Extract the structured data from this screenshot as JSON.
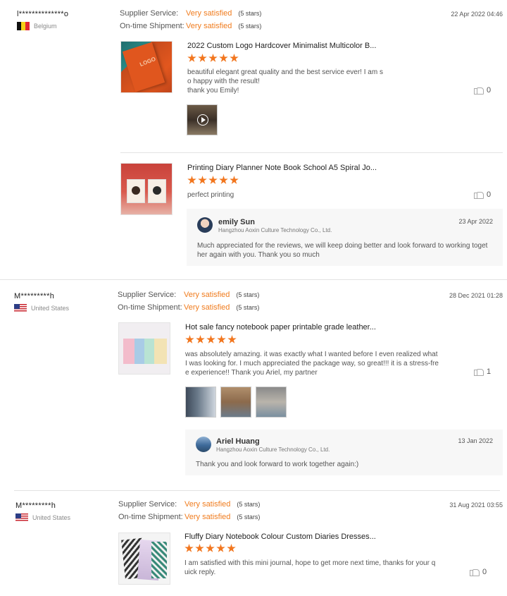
{
  "reviews": [
    {
      "user": "l**************o",
      "country": "Belgium",
      "supplier_service_label": "Supplier Service:",
      "supplier_service_value": "Very satisfied",
      "supplier_service_stars": "(5 stars)",
      "shipment_label": "On-time Shipment:",
      "shipment_value": "Very satisfied",
      "shipment_stars": "(5 stars)",
      "date": "22 Apr 2022 04:46",
      "products": [
        {
          "title": "2022 Custom Logo Hardcover Minimalist Multicolor B...",
          "rating": 5,
          "text": "beautiful elegant great quality and the best service ever! I am so happy with the result!",
          "text2": "thank you Emily!",
          "likes": "0",
          "image_logo": "LOGO"
        },
        {
          "title": "Printing Diary Planner Note Book School A5 Spiral Jo...",
          "rating": 5,
          "text": "perfect printing",
          "likes": "0",
          "reply": {
            "name": "emily Sun",
            "company": "Hangzhou Aoxin Culture Technology Co., Ltd.",
            "date": "23 Apr 2022",
            "text": "Much appreciated for the reviews, we will keep doing better and look forward to working toget her again with you. Thank you so much"
          }
        }
      ]
    },
    {
      "user": "M*********h",
      "country": "United States",
      "supplier_service_label": "Supplier Service:",
      "supplier_service_value": "Very satisfied",
      "supplier_service_stars": "(5 stars)",
      "shipment_label": "On-time Shipment:",
      "shipment_value": "Very satisfied",
      "shipment_stars": "(5 stars)",
      "date": "28 Dec 2021 01:28",
      "products": [
        {
          "title": "Hot sale fancy notebook paper printable grade leather...",
          "rating": 5,
          "text": "was absolutely amazing. it was exactly what I wanted before I even realized what I was looking for. I much appreciated the package way, so great!!! it is a stress-fre e experience!! Thank you Ariel, my partner",
          "likes": "1",
          "reply": {
            "name": "Ariel Huang",
            "company": "Hangzhou Aoxin Culture Technology Co., Ltd.",
            "date": "13 Jan 2022",
            "text": "Thank you and look forward to work together again:)"
          }
        }
      ]
    },
    {
      "user": "M*********h",
      "country": "United States",
      "supplier_service_label": "Supplier Service:",
      "supplier_service_value": "Very satisfied",
      "supplier_service_stars": "(5 stars)",
      "shipment_label": "On-time Shipment:",
      "shipment_value": "Very satisfied",
      "shipment_stars": "(5 stars)",
      "date": "31 Aug 2021 03:55",
      "products": [
        {
          "title": "Fluffy Diary Notebook Colour Custom Diaries Dresses...",
          "rating": 5,
          "text": "I am satisfied with this mini journal, hope to get more next time, thanks for your q uick reply.",
          "likes": "0"
        }
      ]
    }
  ]
}
